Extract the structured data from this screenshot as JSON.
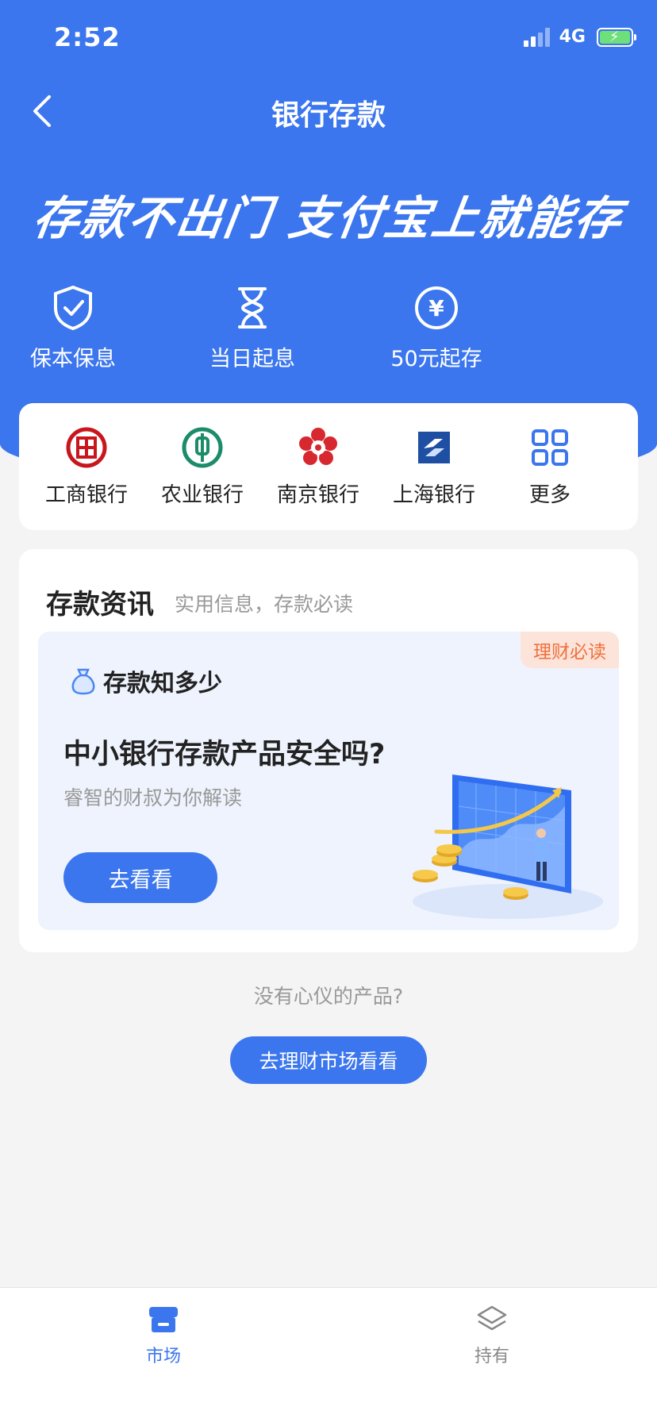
{
  "status_bar": {
    "time": "2:52",
    "network": "4G"
  },
  "nav": {
    "title": "银行存款"
  },
  "hero": {
    "slogan": "存款不出门 支付宝上就能存",
    "features": [
      {
        "icon": "shield-check-icon",
        "label": "保本保息"
      },
      {
        "icon": "hourglass-icon",
        "label": "当日起息"
      },
      {
        "icon": "yen-coin-icon",
        "label": "50元起存"
      }
    ]
  },
  "banks": [
    {
      "icon": "icbc-logo-icon",
      "label": "工商银行"
    },
    {
      "icon": "abc-logo-icon",
      "label": "农业银行"
    },
    {
      "icon": "nanjing-bank-logo-icon",
      "label": "南京银行"
    },
    {
      "icon": "shanghai-bank-logo-icon",
      "label": "上海银行"
    },
    {
      "icon": "grid-more-icon",
      "label": "更多"
    }
  ],
  "info": {
    "title": "存款资讯",
    "subtitle": "实用信息，存款必读",
    "article": {
      "tag": "理财必读",
      "column": "存款知多少",
      "title": "中小银行存款产品安全吗?",
      "subtitle": "睿智的财叔为你解读",
      "button": "去看看"
    }
  },
  "footer": {
    "prompt": "没有心仪的产品?",
    "button": "去理财市场看看"
  },
  "tabbar": [
    {
      "label": "市场",
      "active": true
    },
    {
      "label": "持有",
      "active": false
    }
  ],
  "colors": {
    "primary": "#3b76ee",
    "tag_text": "#f0713d",
    "tag_bg": "#fde4da"
  }
}
